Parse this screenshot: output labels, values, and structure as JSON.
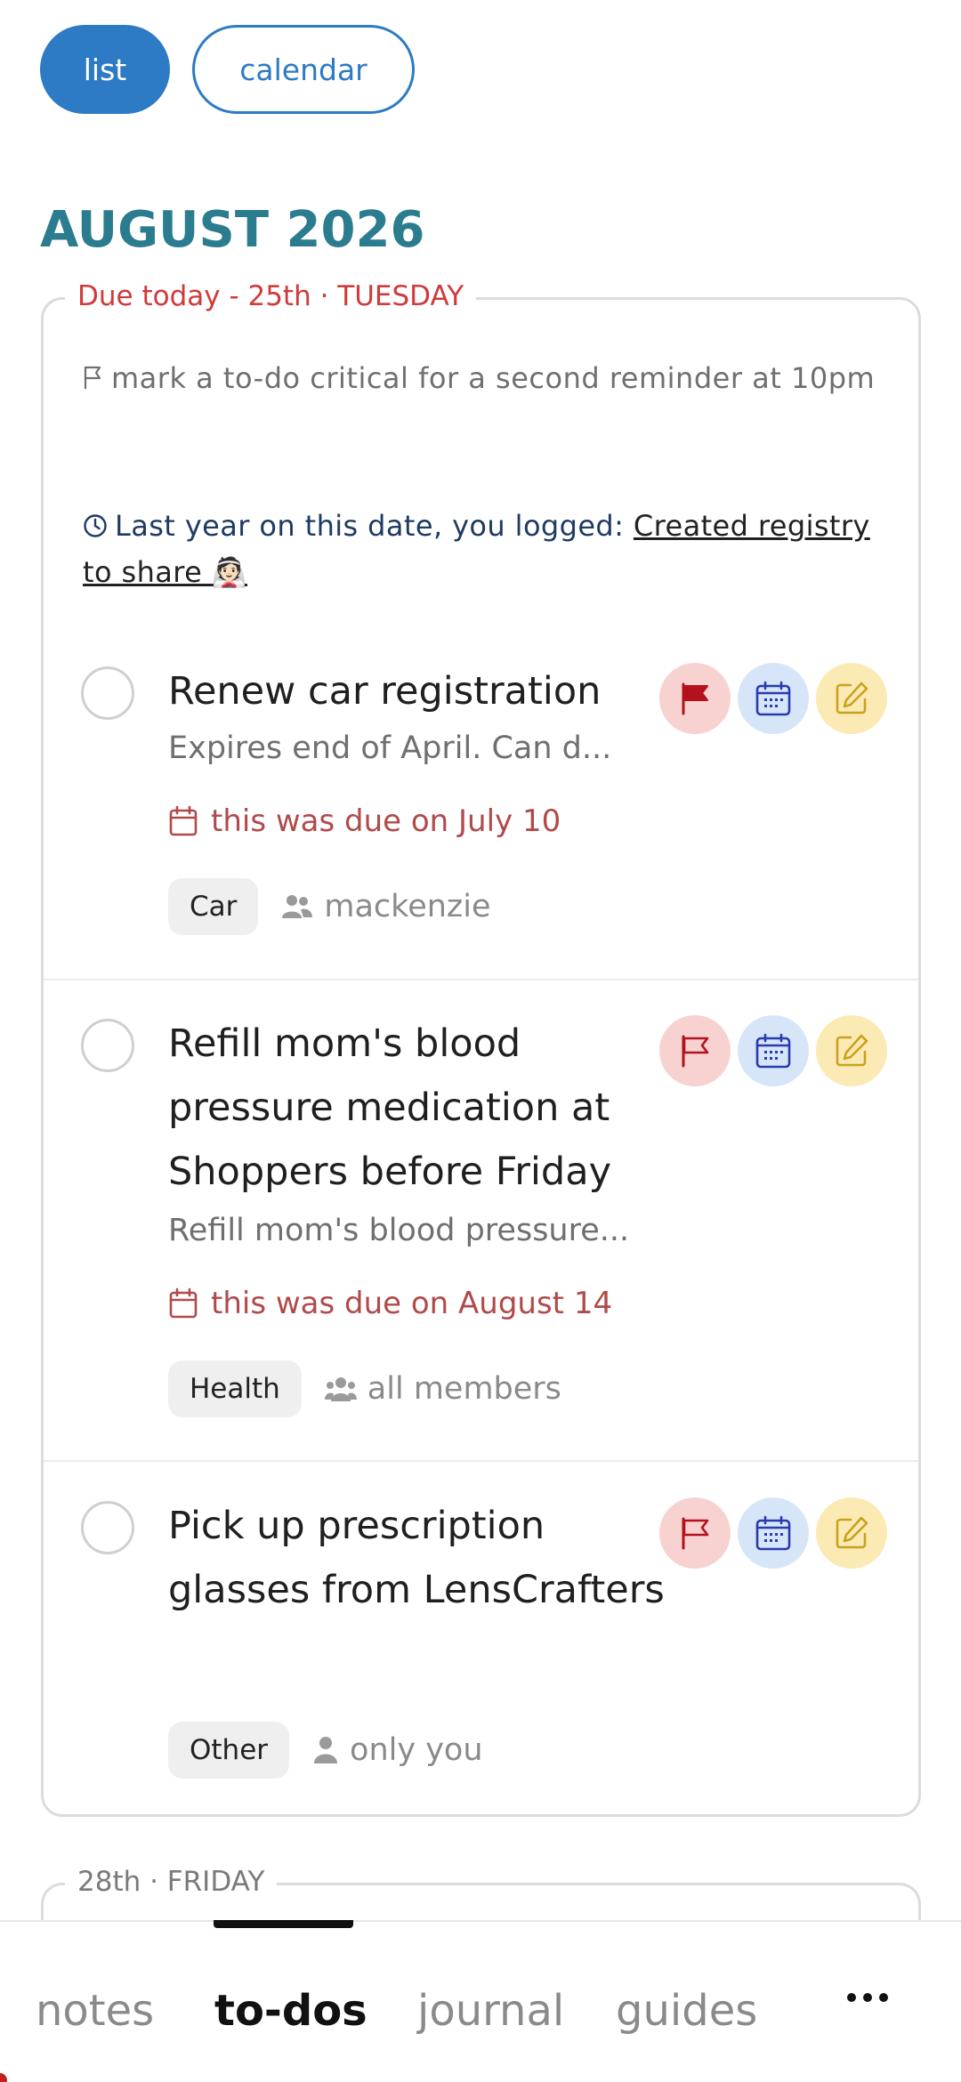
{
  "view_toggle": {
    "list_label": "list",
    "calendar_label": "calendar",
    "active": "list"
  },
  "month_title": "AUGUST 2026",
  "day_today": {
    "legend": "Due today - 25th · TUESDAY",
    "tip": "mark a to-do critical for a second reminder at 10pm",
    "memory_prefix": "Last year on this date, you logged: ",
    "memory_link": "Created registry to share 👰🏻",
    "tasks": [
      {
        "title": "Renew car registration",
        "description": "Expires end of April. Can d...",
        "due_text": "this was due on July 10",
        "tag": "Car",
        "assignee": "mackenzie",
        "assignee_icon": "two-people-icon",
        "flagged": true
      },
      {
        "title": "Refill mom's blood pressure medication at Shoppers before Friday",
        "description": "Refill mom's blood pressure...",
        "due_text": "this was due on August 14",
        "tag": "Health",
        "assignee": "all members",
        "assignee_icon": "group-icon",
        "flagged": false
      },
      {
        "title": "Pick up prescription glasses from LensCrafters",
        "description": "",
        "due_text": "",
        "tag": "Other",
        "assignee": "only you",
        "assignee_icon": "person-icon",
        "flagged": false
      }
    ]
  },
  "day_next": {
    "legend": "28th · FRIDAY"
  },
  "bottom_nav": {
    "items": [
      "notes",
      "to-dos",
      "journal",
      "guides"
    ],
    "active": "to-dos",
    "more_label": "more-icon"
  },
  "colors": {
    "accent_blue": "#2d7bc4",
    "month_teal": "#2b7c8f",
    "due_red": "#d03a3a",
    "flag_red": "#b3121c",
    "calendar_blue": "#2a3bb0",
    "edit_gold": "#c9a21c"
  }
}
